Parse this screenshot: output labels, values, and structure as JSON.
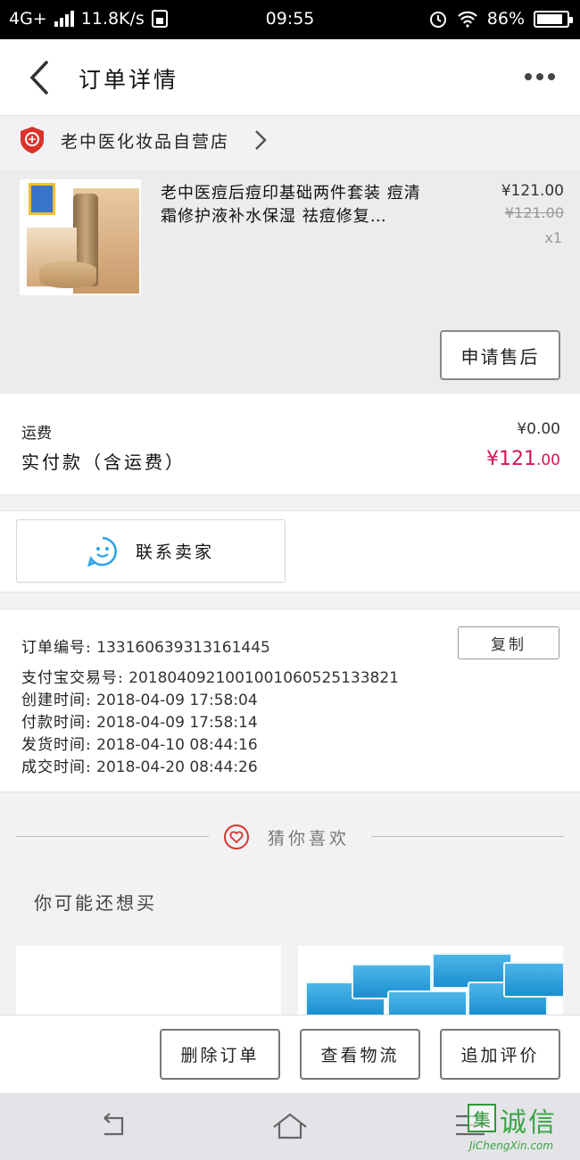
{
  "status_bar": {
    "network": "4G+",
    "speed": "11.8K/s",
    "time": "09:55",
    "battery": "86%"
  },
  "header": {
    "title": "订单详情"
  },
  "store": {
    "name": "老中医化妆品自营店"
  },
  "product": {
    "name": "老中医痘后痘印基础两件套装 痘清霜修护液补水保湿 祛痘修复…",
    "price": "¥121.00",
    "original_price": "¥121.00",
    "quantity": "x1",
    "after_sale_label": "申请售后"
  },
  "totals": {
    "shipping_label": "运费",
    "shipping_value": "¥0.00",
    "paid_label": "实付款（含运费）",
    "paid_value_main": "¥121",
    "paid_value_cents": ".00"
  },
  "contact": {
    "label": "联系卖家"
  },
  "order_info": {
    "copy_label": "复制",
    "rows": [
      {
        "key": "订单编号:",
        "value": "133160639313161445"
      },
      {
        "key": "支付宝交易号:",
        "value": "2018040921001001060525133821"
      },
      {
        "key": "创建时间:",
        "value": "2018-04-09 17:58:04"
      },
      {
        "key": "付款时间:",
        "value": "2018-04-09 17:58:14"
      },
      {
        "key": "发货时间:",
        "value": "2018-04-10 08:44:16"
      },
      {
        "key": "成交时间:",
        "value": "2018-04-20 08:44:26"
      }
    ]
  },
  "recommend": {
    "divider_label": "猜你喜欢",
    "subtitle": "你可能还想买"
  },
  "actions": {
    "delete": "删除订单",
    "logistics": "查看物流",
    "review": "追加评价"
  },
  "watermark": {
    "cn": "诚信",
    "en": "JiChengXin.com",
    "logo_char": "集"
  },
  "colors": {
    "accent": "#d4145a",
    "contact_icon": "#2fa4e7",
    "store_shield": "#d9332b"
  }
}
